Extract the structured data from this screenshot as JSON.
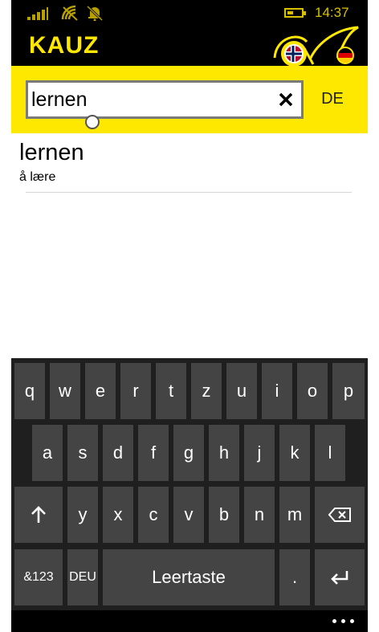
{
  "status": {
    "time": "14:37",
    "battery_level": 0.45,
    "icons": [
      "signal-icon",
      "wifi-icon",
      "bell-muted-icon",
      "battery-icon"
    ]
  },
  "app": {
    "title": "KAUZ",
    "logo": "kauz-owl-logo"
  },
  "search": {
    "value": "lernen",
    "placeholder": "",
    "clear_icon": "close-icon",
    "lang_label": "DE"
  },
  "results": [
    {
      "word": "lernen",
      "translation": "å lære"
    }
  ],
  "keyboard": {
    "row1": [
      "q",
      "w",
      "e",
      "r",
      "t",
      "z",
      "u",
      "i",
      "o",
      "p"
    ],
    "row2": [
      "a",
      "s",
      "d",
      "f",
      "g",
      "h",
      "j",
      "k",
      "l"
    ],
    "row3": [
      "y",
      "x",
      "c",
      "v",
      "b",
      "n",
      "m"
    ],
    "shift_icon": "shift-up-arrow-icon",
    "backspace_icon": "backspace-icon",
    "numbers_label": "&123",
    "lang_label": "DEU",
    "space_label": "Leertaste",
    "period_label": ".",
    "enter_icon": "enter-icon"
  },
  "appbar": {
    "more_icon": "more-dots-icon"
  },
  "colors": {
    "accent_yellow": "#ffe800",
    "status_gold": "#d8c000",
    "key_bg": "#444444",
    "keyboard_bg": "#1f1f1f"
  }
}
